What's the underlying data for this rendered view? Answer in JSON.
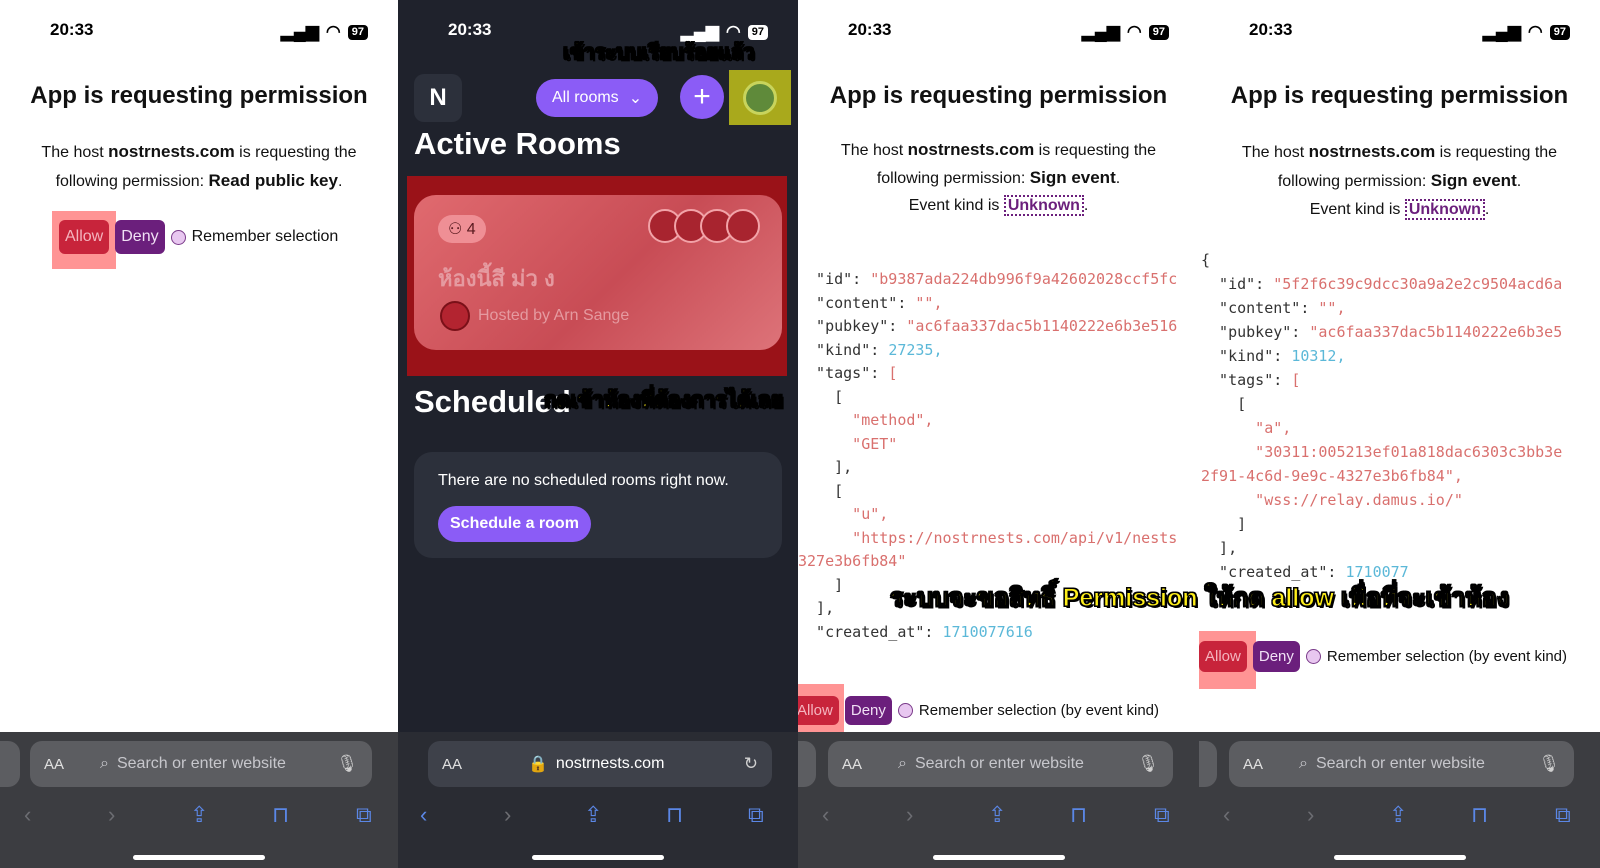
{
  "status": {
    "time": "20:33",
    "battery": "97"
  },
  "panel1": {
    "title": "App is requesting permission",
    "line1_pre": "The host ",
    "host": "nostrnests.com",
    "line1_post": " is requesting the",
    "line2_pre": "following permission: ",
    "permission": "Read public key",
    "line2_post": ".",
    "allow": "Allow",
    "deny": "Deny",
    "remember": "Remember selection"
  },
  "panel2": {
    "logo": "N",
    "rooms_filter": "All rooms",
    "plus": "+",
    "active_rooms": "Active Rooms",
    "room_count": "4",
    "room_name": "ห้องนี้สี ม่ว ง",
    "hosted_by": "Hosted by Arn Sange",
    "scheduled_title": "Scheduled",
    "no_rooms": "There are no scheduled rooms right now.",
    "schedule_button": "Schedule a room",
    "url": "nostrnests.com",
    "caption_top": "เข้าระบบเรียบร้อยแล้ว",
    "caption_mid": "กดเข้าห้องที่ต้องการได้เลย"
  },
  "panel3": {
    "title": "App is requesting permission",
    "line1_pre": "The host ",
    "host": "nostrnests.com",
    "line1_post": " is requesting the",
    "line2_pre": "following permission: ",
    "permission": "Sign event",
    "line2_post": ".",
    "line3_pre": "Event kind is ",
    "event_kind": "Unknown",
    "line3_post": ".",
    "json_lines": [
      "  \"id\": \"b9387ada224db996f9a42602028ccf5fc",
      "  \"content\": \"\",",
      "  \"pubkey\": \"ac6faa337dac5b1140222e6b3e516",
      "  \"kind\": 27235,",
      "  \"tags\": [",
      "    [",
      "      \"method\",",
      "      \"GET\"",
      "    ],",
      "    [",
      "      \"u\",",
      "      \"https://nostrnests.com/api/v1/nests",
      "327e3b6fb84\"",
      "    ]",
      "  ],",
      "  \"created_at\": 1710077616"
    ],
    "allow": "Allow",
    "deny": "Deny",
    "remember": "Remember selection (by event kind)"
  },
  "panel4": {
    "title": "App is requesting permission",
    "line1_pre": "The host ",
    "host": "nostrnests.com",
    "line1_post": " is requesting the",
    "line2_pre": "following permission: ",
    "permission": "Sign event",
    "line2_post": ".",
    "line3_pre": "Event kind is ",
    "event_kind": "Unknown",
    "line3_post": ".",
    "json_lines": [
      "{",
      "  \"id\": \"5f2f6c39c9dcc30a9a2e2c9504acd6a",
      "  \"content\": \"\",",
      "  \"pubkey\": \"ac6faa337dac5b1140222e6b3e5",
      "  \"kind\": 10312,",
      "  \"tags\": [",
      "    [",
      "      \"a\",",
      "      \"30311:005213ef01a818dac6303c3bb3e",
      "2f91-4c6d-9e9c-4327e3b6fb84\",",
      "      \"wss://relay.damus.io/\"",
      "    ]",
      "  ],",
      "  \"created_at\": 1710077"
    ],
    "allow": "Allow",
    "deny": "Deny",
    "remember": "Remember selection (by event kind)"
  },
  "caption_bottom": "ระบบจะขอสิทธิ์ Permission ให้กด allow เพื่อที่จะเข้าห้อง",
  "safari": {
    "aa": "AA",
    "search_placeholder": "Search or enter website"
  }
}
